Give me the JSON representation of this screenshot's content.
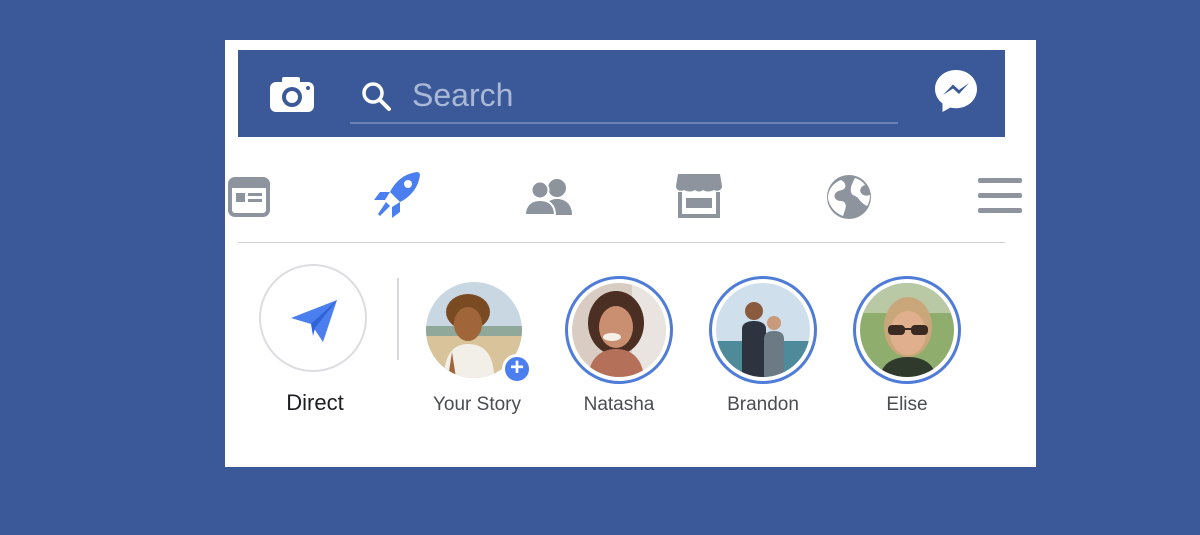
{
  "header": {
    "camera_icon": "camera-icon",
    "search": {
      "placeholder": "Search",
      "icon": "search-icon"
    },
    "messenger_icon": "messenger-icon"
  },
  "nav": {
    "tabs": [
      {
        "icon": "news-feed-icon",
        "active": false
      },
      {
        "icon": "rocket-icon",
        "active": true
      },
      {
        "icon": "friends-icon",
        "active": false
      },
      {
        "icon": "marketplace-icon",
        "active": false
      },
      {
        "icon": "globe-icon",
        "active": false
      },
      {
        "icon": "menu-icon",
        "active": false
      }
    ]
  },
  "stories": {
    "direct": {
      "label": "Direct",
      "icon": "paper-plane-icon"
    },
    "items": [
      {
        "label": "Your Story",
        "add_badge": "+"
      },
      {
        "label": "Natasha"
      },
      {
        "label": "Brandon"
      },
      {
        "label": "Elise"
      }
    ]
  },
  "colors": {
    "brand": "#3b5998",
    "accent": "#4b7ff0",
    "icon_gray": "#8d949e",
    "story_ring": "#4f7cd8"
  }
}
